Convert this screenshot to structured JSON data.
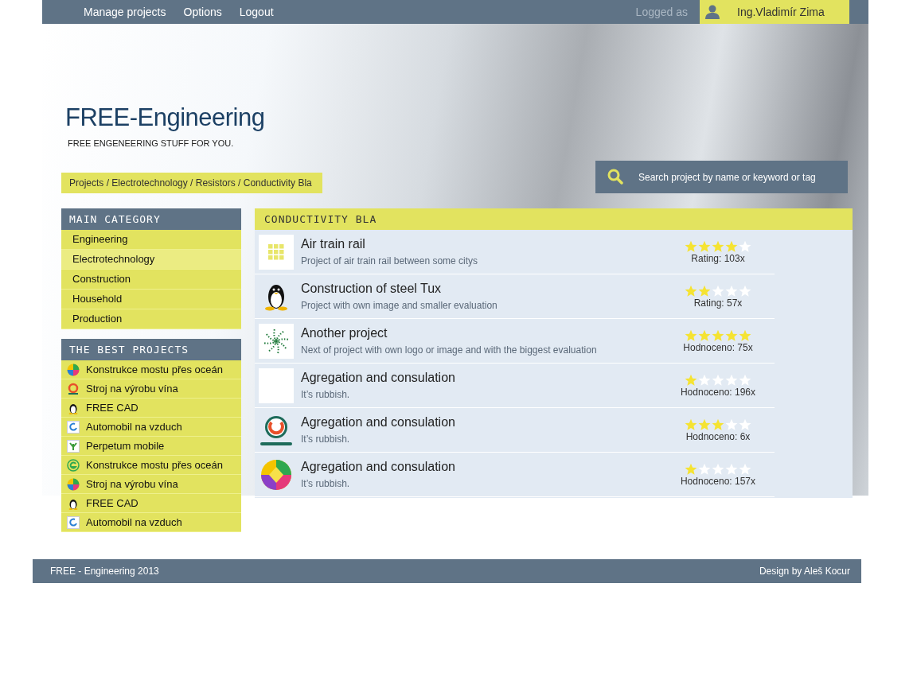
{
  "top_nav": {
    "links": [
      "Manage projects",
      "Options",
      "Logout"
    ],
    "logged_label": "Logged as",
    "user_name": "Ing.Vladimír Zima"
  },
  "header": {
    "title": "FREE-Engineering",
    "tagline": "FREE ENGENEERING STUFF FOR YOU."
  },
  "breadcrumb": "Projects / Electrotechnology / Resistors / Conductivity Bla",
  "search": {
    "placeholder": "Search project by name or keyword or tag"
  },
  "main_category": {
    "heading": "MAIN CATEGORY",
    "items": [
      {
        "label": "Engineering",
        "selected": false
      },
      {
        "label": "Electrotechnology",
        "selected": true
      },
      {
        "label": "Construction",
        "selected": false
      },
      {
        "label": "Household",
        "selected": false
      },
      {
        "label": "Production",
        "selected": false
      }
    ]
  },
  "best_projects": {
    "heading": "THE BEST PROJECTS",
    "items": [
      {
        "label": "Konstrukce mostu přes oceán",
        "kind": "ball"
      },
      {
        "label": "Stroj na výrobu vína",
        "kind": "ring"
      },
      {
        "label": "FREE CAD",
        "kind": "penguin"
      },
      {
        "label": "Automobil na vzduch",
        "kind": "swirl"
      },
      {
        "label": "Perpetum mobile",
        "kind": "plant"
      },
      {
        "label": "Konstrukce mostu přes oceán",
        "kind": "e-circle"
      },
      {
        "label": "Stroj na výrobu vína",
        "kind": "ball"
      },
      {
        "label": "FREE CAD",
        "kind": "penguin"
      },
      {
        "label": "Automobil na vzduch",
        "kind": "swirl"
      }
    ]
  },
  "projects": {
    "heading": "CONDUCTIVITY BLA",
    "items": [
      {
        "title": "Air train rail",
        "description": "Project of air train rail between some citys",
        "stars": 4,
        "rating": "Rating: 103x",
        "kind": "grid"
      },
      {
        "title": "Construction of steel Tux",
        "description": "Project with own image and smaller evaluation",
        "stars": 2,
        "rating": "Rating: 57x",
        "kind": "penguin"
      },
      {
        "title": "Another project",
        "description": "Next of project with own logo or image and with the biggest evaluation",
        "stars": 5,
        "rating": "Hodnoceno: 75x",
        "kind": "spiral"
      },
      {
        "title": "Agregation and consulation",
        "description": "It’s rubbish.",
        "stars": 1,
        "rating": "Hodnoceno: 196x",
        "kind": "blank"
      },
      {
        "title": "Agregation and consulation",
        "description": "It’s rubbish.",
        "stars": 3,
        "rating": "Hodnoceno: 6x",
        "kind": "ring"
      },
      {
        "title": "Agregation and consulation",
        "description": "It’s rubbish.",
        "stars": 1,
        "rating": "Hodnoceno: 157x",
        "kind": "ball"
      }
    ]
  },
  "footer": {
    "left": "FREE - Engineering 2013",
    "right": "Design by Aleš Kocur"
  }
}
